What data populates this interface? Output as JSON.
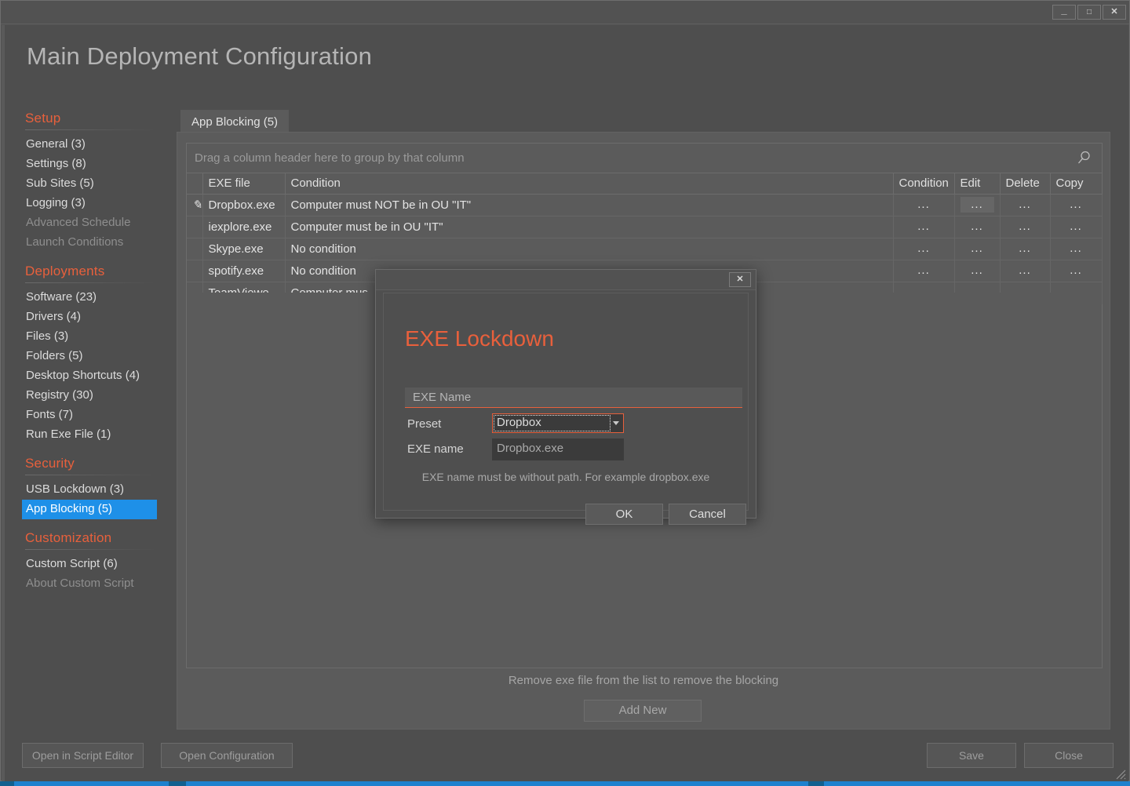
{
  "window": {
    "minimize_label": "—",
    "maximize_label": "❐",
    "close_label": "✕"
  },
  "page_title": "Main Deployment Configuration",
  "sidebar": {
    "groups": [
      {
        "title": "Setup",
        "items": [
          {
            "label": "General (3)",
            "state": "normal"
          },
          {
            "label": "Settings (8)",
            "state": "normal"
          },
          {
            "label": "Sub Sites (5)",
            "state": "normal"
          },
          {
            "label": "Logging (3)",
            "state": "normal"
          },
          {
            "label": "Advanced Schedule",
            "state": "disabled"
          },
          {
            "label": "Launch Conditions",
            "state": "disabled"
          }
        ]
      },
      {
        "title": "Deployments",
        "items": [
          {
            "label": "Software (23)",
            "state": "normal"
          },
          {
            "label": "Drivers (4)",
            "state": "normal"
          },
          {
            "label": "Files (3)",
            "state": "normal"
          },
          {
            "label": "Folders (5)",
            "state": "normal"
          },
          {
            "label": "Desktop Shortcuts (4)",
            "state": "normal"
          },
          {
            "label": "Registry (30)",
            "state": "normal"
          },
          {
            "label": "Fonts (7)",
            "state": "normal"
          },
          {
            "label": "Run Exe File (1)",
            "state": "normal"
          }
        ]
      },
      {
        "title": "Security",
        "items": [
          {
            "label": "USB Lockdown (3)",
            "state": "normal"
          },
          {
            "label": "App Blocking (5)",
            "state": "active"
          }
        ]
      },
      {
        "title": "Customization",
        "items": [
          {
            "label": "Custom Script (6)",
            "state": "normal"
          },
          {
            "label": "About Custom Script",
            "state": "disabled"
          }
        ]
      }
    ]
  },
  "tabs": [
    {
      "label": "App Blocking (5)",
      "active": true
    }
  ],
  "grid": {
    "group_hint": "Drag a column header here to group by that column",
    "search_icon": "search-icon",
    "columns": [
      "",
      "EXE file",
      "Condition",
      "Condition",
      "Edit",
      "Delete",
      "Copy"
    ],
    "action_cell_label": "...",
    "rows": [
      {
        "indicator": "pencil-icon",
        "exe_file": "Dropbox.exe",
        "condition": "Computer must NOT be in OU \"IT\"",
        "condition_btn": "...",
        "edit_btn": "...",
        "delete_btn": "...",
        "copy_btn": "...",
        "edit_hover": true
      },
      {
        "indicator": "",
        "exe_file": "iexplore.exe",
        "condition": "Computer must be in OU \"IT\"",
        "condition_btn": "...",
        "edit_btn": "...",
        "delete_btn": "...",
        "copy_btn": "...",
        "edit_hover": false
      },
      {
        "indicator": "",
        "exe_file": "Skype.exe",
        "condition": "No condition",
        "condition_btn": "...",
        "edit_btn": "...",
        "delete_btn": "...",
        "copy_btn": "...",
        "edit_hover": false
      },
      {
        "indicator": "",
        "exe_file": "spotify.exe",
        "condition": "No condition",
        "condition_btn": "...",
        "edit_btn": "...",
        "delete_btn": "...",
        "copy_btn": "...",
        "edit_hover": false
      },
      {
        "indicator": "",
        "exe_file": "TeamViewe...",
        "condition": "Computer mus",
        "condition_btn": "...",
        "edit_btn": "...",
        "delete_btn": "...",
        "copy_btn": "...",
        "edit_hover": false
      }
    ],
    "remove_hint": "Remove exe file from the list to remove the blocking",
    "add_new_label": "Add New"
  },
  "bottom_bar": {
    "open_script_editor": "Open in Script Editor",
    "open_configuration": "Open Configuration",
    "save": "Save",
    "close": "Close"
  },
  "modal": {
    "close_label": "✕",
    "title": "EXE Lockdown",
    "exe_name_placeholder": "EXE Name",
    "exe_name_value": "",
    "preset_label": "Preset",
    "preset_value": "Dropbox",
    "exe_name_label": "EXE name",
    "exe_name_display": "Dropbox.exe",
    "help_text": "EXE name must be without path. For example dropbox.exe",
    "ok_label": "OK",
    "cancel_label": "Cancel"
  },
  "colors": {
    "accent_orange": "#e8603c",
    "accent_blue": "#1e90e8",
    "window_bg": "#4e4e4e",
    "panel_bg": "#5b5b5b"
  }
}
